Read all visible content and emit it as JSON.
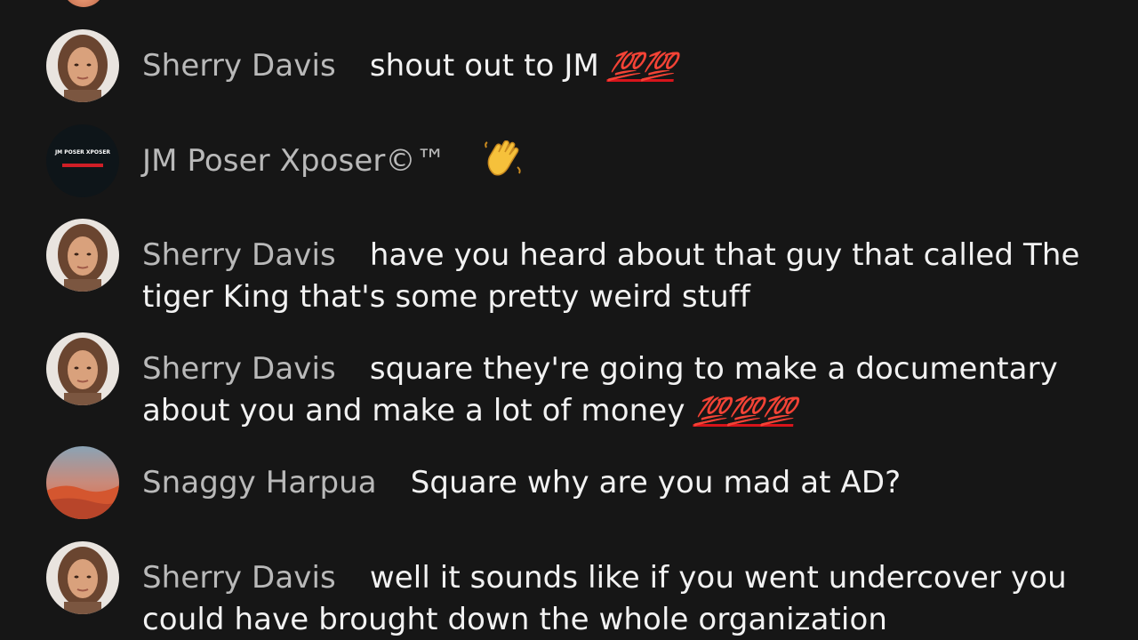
{
  "chat": {
    "messages": [
      {
        "author": "Sherry Davis",
        "text": "shout out to JM",
        "emoji_suffix": "💯💯",
        "avatar": "woman-portrait-avatar"
      },
      {
        "author": "JM Poser Xposer©™",
        "text": "",
        "emoji": "waving-hand",
        "avatar": "jm-poser-xposer-logo-avatar",
        "avatar_logo_text": "JM POSER XPOSER"
      },
      {
        "author": "Sherry Davis",
        "text": "have you heard about that guy that called The tiger King that's some pretty weird stuff",
        "avatar": "woman-portrait-avatar"
      },
      {
        "author": "Sherry Davis",
        "text": "square they're going to make a documentary about you and make a lot of money",
        "emoji_suffix": "💯💯💯",
        "avatar": "woman-portrait-avatar"
      },
      {
        "author": "Snaggy Harpua",
        "text": "Square why are you mad at AD?",
        "avatar": "landscape-avatar"
      },
      {
        "author": "Sherry Davis",
        "text": "well it sounds like if you went undercover you could have brought down the whole organization",
        "avatar": "woman-portrait-avatar"
      }
    ]
  },
  "colors": {
    "background": "#161616",
    "author_name": "#b9b9b9",
    "message_text": "#f2f2f2",
    "hundred_emoji": "#d7141b"
  }
}
